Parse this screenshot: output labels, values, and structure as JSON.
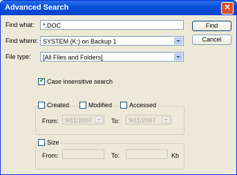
{
  "window": {
    "title": "Advanced Search"
  },
  "search": {
    "find_what_label": "Find what:",
    "find_what_value": "*.DOC",
    "find_where_label": "Find where:",
    "find_where_value": "SYSTEM (K:)    on Backup 1",
    "file_type_label": "File type:",
    "file_type_value": "[All Files and Folders]"
  },
  "buttons": {
    "find": "Find",
    "cancel": "Cancel"
  },
  "options": {
    "case_insensitive_label": "Case insensitive search",
    "case_insensitive_checked": true
  },
  "dates": {
    "created_label": "Created",
    "modified_label": "Modified",
    "accessed_label": "Accessed",
    "from_label": "From:",
    "to_label": "To:",
    "from_value": "9/11/2007",
    "to_value": "9/11/2007"
  },
  "size": {
    "label": "Size",
    "from_label": "From:",
    "to_label": "To:",
    "unit": "Kb"
  },
  "colors": {
    "titlebar": "#0a4fd8",
    "dialog_bg": "#ece9d8",
    "check": "#21a121"
  }
}
